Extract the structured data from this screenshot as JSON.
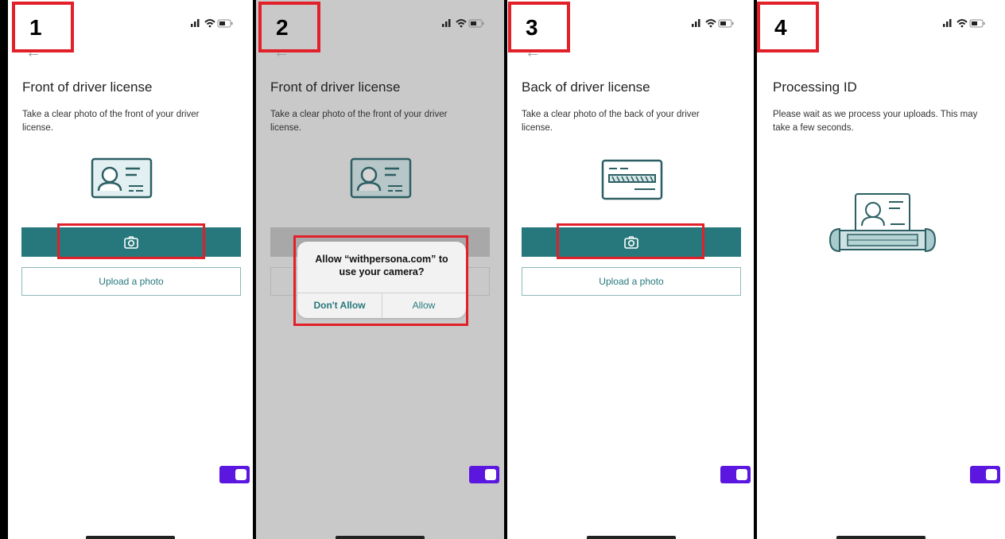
{
  "steps": [
    {
      "number": "1",
      "title": "Front of driver license",
      "description": "Take a clear photo of the front of your driver license.",
      "camera_icon": "camera-icon",
      "upload_label": "Upload a photo"
    },
    {
      "number": "2",
      "title": "Front of driver license",
      "description": "Take a clear photo of the front of your driver license.",
      "dialog": {
        "title": "Allow “withpersona.com” to use your camera?",
        "deny_label": "Don't Allow",
        "allow_label": "Allow"
      }
    },
    {
      "number": "3",
      "title": "Back of driver license",
      "description": "Take a clear photo of the back of your driver license.",
      "camera_icon": "camera-icon",
      "upload_label": "Upload a photo"
    },
    {
      "number": "4",
      "title": "Processing ID",
      "description": "Please wait as we process your uploads. This may take a few seconds."
    }
  ],
  "colors": {
    "accent": "#26787c",
    "highlight": "#e2202a",
    "toggle": "#5b16e0",
    "dim_background": "#c9c9c9"
  }
}
